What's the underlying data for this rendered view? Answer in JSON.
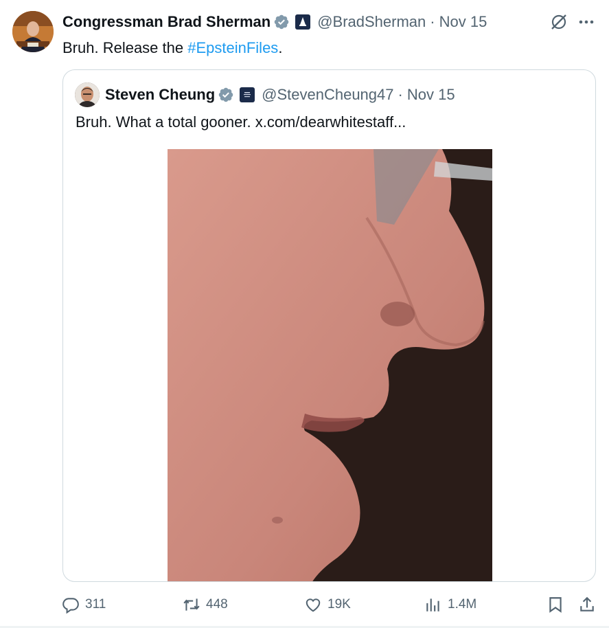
{
  "tweet": {
    "author_name": "Congressman Brad Sherman",
    "handle": "@BradSherman",
    "separator": "·",
    "date": "Nov 15",
    "text_prefix": "Bruh. Release the ",
    "hashtag": "#EpsteinFiles",
    "text_suffix": "."
  },
  "quoted_tweet": {
    "author_name": "Steven Cheung",
    "handle": "@StevenCheung47",
    "separator": "·",
    "date": "Nov 15",
    "text": "Bruh. What a total gooner.  x.com/dearwhitestaff..."
  },
  "actions": {
    "replies": "311",
    "reposts": "448",
    "likes": "19K",
    "views": "1.4M"
  },
  "icons": {
    "verified": "verified-badge-icon",
    "affiliation": "government-affiliation-icon",
    "grok": "grok-icon",
    "more": "more-icon",
    "reply": "reply-icon",
    "repost": "repost-icon",
    "like": "like-icon",
    "views": "views-icon",
    "bookmark": "bookmark-icon",
    "share": "share-icon"
  },
  "colors": {
    "accent": "#1d9bf0",
    "muted": "#536471",
    "verified_badge": "#829aab"
  }
}
